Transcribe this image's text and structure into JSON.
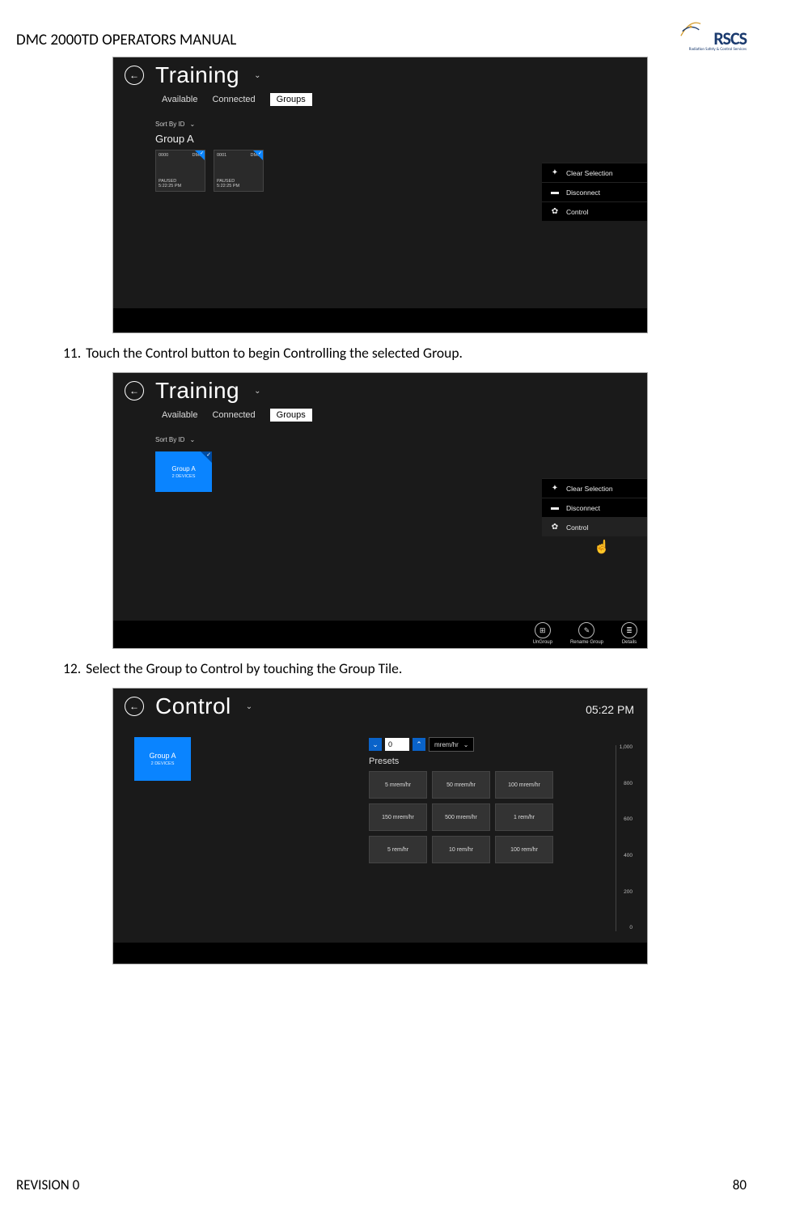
{
  "doc_title": "DMC 2000TD OPERATORS MANUAL",
  "logo": {
    "text": "RSCS",
    "sub": "Radiation Safety & Control Services"
  },
  "footer": {
    "revision": "REVISION 0",
    "page": "80"
  },
  "steps": {
    "s11": {
      "num": "11.",
      "text": "Touch the Control button to begin Controlling the selected Group."
    },
    "s12": {
      "num": "12.",
      "text": "Select the Group to Control by touching the Group Tile."
    }
  },
  "shot1": {
    "title": "Training",
    "tabs": {
      "a": "Available",
      "b": "Connected",
      "c": "Groups"
    },
    "sort": "Sort By ID",
    "group": "Group A",
    "dev1": {
      "id": "0000",
      "type": "DMC",
      "status": "PAUSED",
      "time": "5:22:25 PM"
    },
    "dev2": {
      "id": "0001",
      "type": "DMC",
      "status": "PAUSED",
      "time": "5:22:25 PM"
    },
    "actions": {
      "clear": "Clear Selection",
      "disc": "Disconnect",
      "ctrl": "Control"
    }
  },
  "shot2": {
    "title": "Training",
    "tabs": {
      "a": "Available",
      "b": "Connected",
      "c": "Groups"
    },
    "sort": "Sort By ID",
    "tile": {
      "name": "Group A",
      "sub": "2 DEVICES"
    },
    "actions": {
      "clear": "Clear Selection",
      "disc": "Disconnect",
      "ctrl": "Control"
    },
    "bottom": {
      "ungroup": "UnGroup",
      "rename": "Rename Group",
      "details": "Details"
    }
  },
  "shot3": {
    "title": "Control",
    "time": "05:22 PM",
    "tile": {
      "name": "Group A",
      "sub": "2 DEVICES"
    },
    "value": "0",
    "unit": "mrem/hr",
    "presets_label": "Presets",
    "presets": [
      "5  mrem/hr",
      "50 mrem/hr",
      "100 mrem/hr",
      "150 mrem/hr",
      "500  mrem/hr",
      "1 rem/hr",
      "5 rem/hr",
      "10 rem/hr",
      "100 rem/hr"
    ],
    "scale": [
      "1,000",
      "800",
      "600",
      "400",
      "200",
      "0"
    ]
  }
}
